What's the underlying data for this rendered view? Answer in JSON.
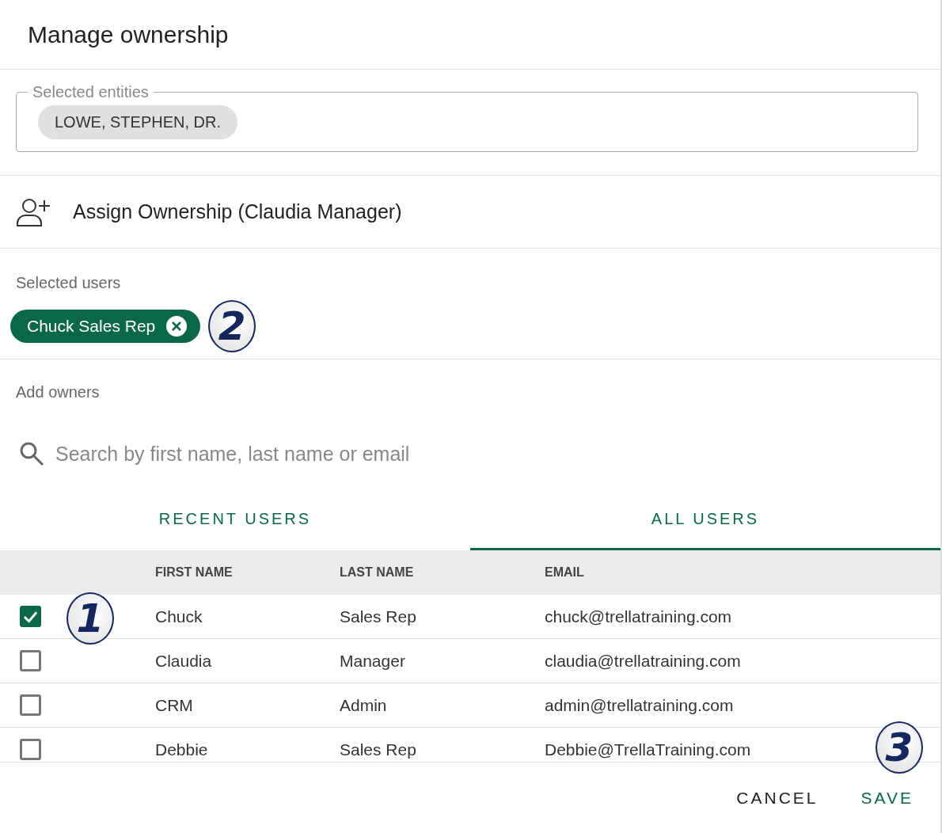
{
  "dialog": {
    "title": "Manage ownership"
  },
  "selected_entities": {
    "legend": "Selected entities",
    "chips": [
      "LOWE, STEPHEN, DR."
    ]
  },
  "assign": {
    "label": "Assign Ownership (Claudia Manager)"
  },
  "selected_users": {
    "label": "Selected users",
    "chips": [
      {
        "label": "Chuck Sales Rep",
        "annotation": "2"
      }
    ]
  },
  "add_owners": {
    "label": "Add owners",
    "search": {
      "placeholder": "Search by first name, last name or email"
    }
  },
  "tabs": [
    {
      "label": "RECENT USERS",
      "selected": false
    },
    {
      "label": "ALL USERS",
      "selected": true
    }
  ],
  "table": {
    "columns": [
      "FIRST NAME",
      "LAST NAME",
      "EMAIL"
    ],
    "rows": [
      {
        "checked": true,
        "first_name": "Chuck",
        "last_name": "Sales Rep",
        "email": "chuck@trellatraining.com",
        "annotation": "1"
      },
      {
        "checked": false,
        "first_name": "Claudia",
        "last_name": "Manager",
        "email": "claudia@trellatraining.com"
      },
      {
        "checked": false,
        "first_name": "CRM",
        "last_name": "Admin",
        "email": "admin@trellatraining.com"
      },
      {
        "checked": false,
        "first_name": "Debbie",
        "last_name": "Sales Rep",
        "email": "Debbie@TrellaTraining.com"
      }
    ]
  },
  "footer": {
    "buttons": [
      {
        "label": "CANCEL",
        "kind": "secondary"
      },
      {
        "label": "SAVE",
        "kind": "primary"
      }
    ],
    "annotation": "3"
  }
}
